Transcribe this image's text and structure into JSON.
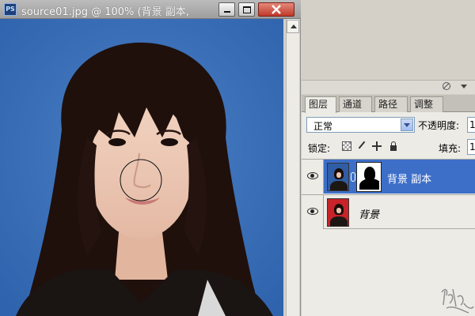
{
  "document": {
    "title": "source01.jpg @ 100% (背景 副本,",
    "app_icon": "PS"
  },
  "window_buttons": [
    "minimize-icon",
    "maximize-icon",
    "close-icon"
  ],
  "layers_panel": {
    "tabs": [
      {
        "label": "图层",
        "active": true
      },
      {
        "label": "通道",
        "active": false
      },
      {
        "label": "路径",
        "active": false
      },
      {
        "label": "调整",
        "active": false
      }
    ],
    "blend_mode": "正常",
    "opacity_label": "不透明度:",
    "opacity_value": "1",
    "lock_label": "锁定:",
    "fill_label": "填充:",
    "fill_value": "1",
    "layers": [
      {
        "name": "背景 副本",
        "selected": true,
        "has_mask": true,
        "visible": true
      },
      {
        "name": "背景",
        "selected": false,
        "has_mask": false,
        "visible": true
      }
    ]
  },
  "colors": {
    "canvas_background": "#3f73b8",
    "selected_layer": "#3d6fc9"
  }
}
